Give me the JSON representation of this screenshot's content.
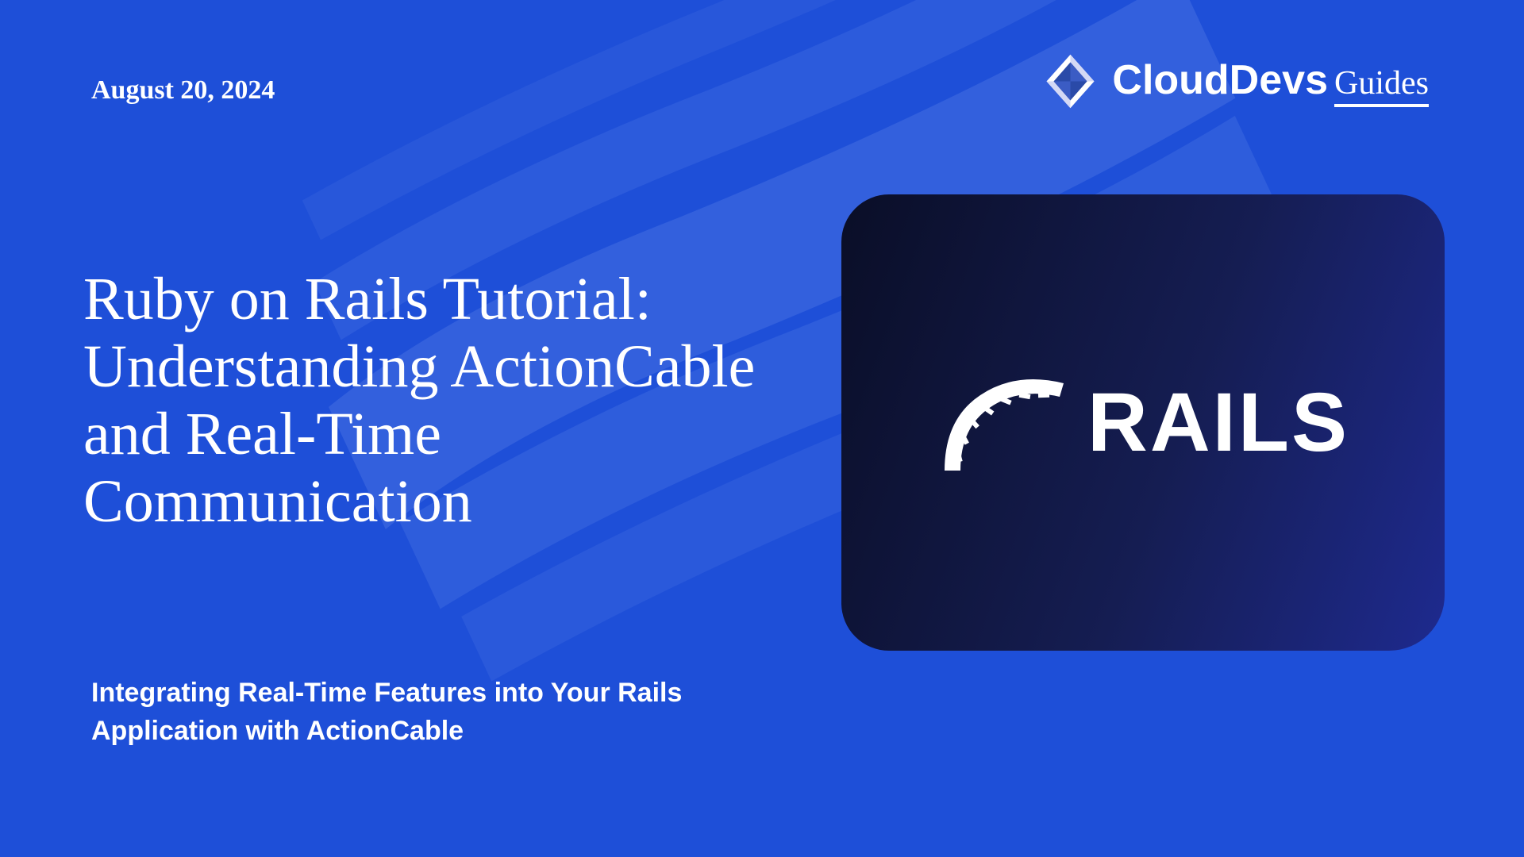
{
  "date": "August 20, 2024",
  "title": "Ruby on Rails Tutorial: Understanding ActionCable and Real-Time Communication",
  "subtitle": "Integrating Real-Time Features into Your Rails Application with ActionCable",
  "brand": {
    "main": "CloudDevs",
    "sub": "Guides"
  },
  "hero_logo_text": "RAILS"
}
